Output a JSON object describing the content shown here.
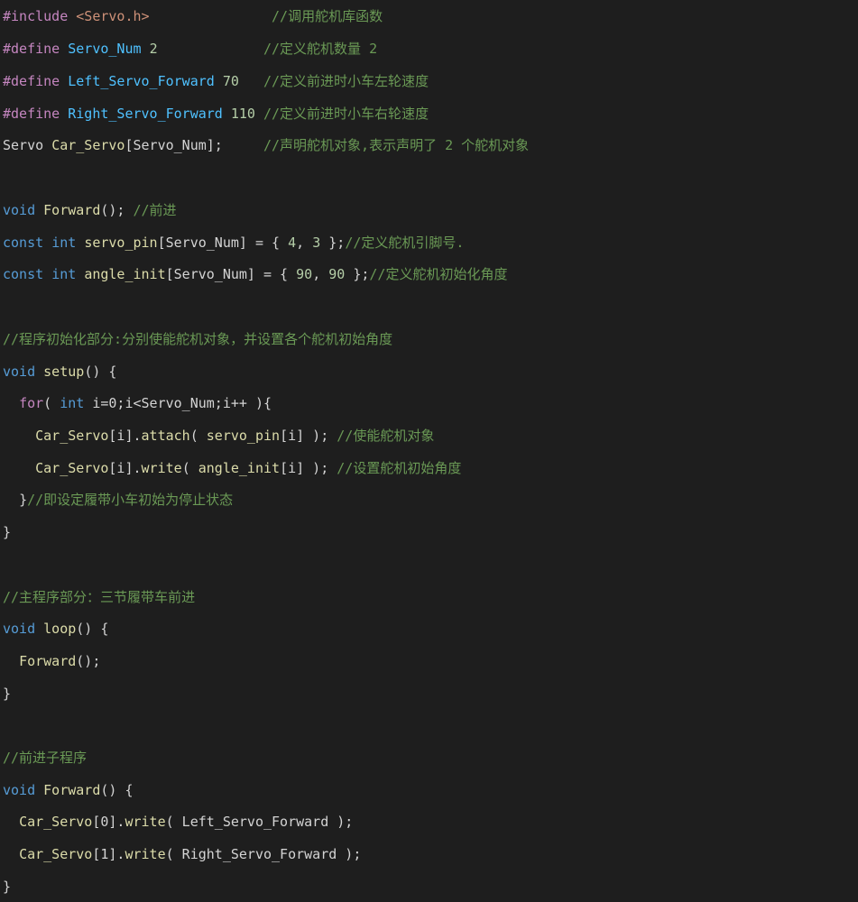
{
  "colors": {
    "background": "#1e1e1e",
    "keyword": "#569cd6",
    "preprocessor": "#c586c0",
    "string": "#ce9178",
    "macro": "#4fc1ff",
    "number": "#b5cea8",
    "function": "#dcdcaa",
    "identifier": "#9cdcfe",
    "comment": "#6a9955",
    "plain": "#d4d4d4"
  },
  "code": {
    "l1": {
      "t1": "#include",
      "t2": " ",
      "t3": "<Servo.h>",
      "t4": "               ",
      "t5": "//调用舵机库函数"
    },
    "l2": {
      "t1": "#define",
      "t2": " ",
      "t3": "Servo_Num",
      "t4": " ",
      "t5": "2",
      "t6": "             ",
      "t7": "//定义舵机数量 2"
    },
    "l3": {
      "t1": "#define",
      "t2": " ",
      "t3": "Left_Servo_Forward",
      "t4": " ",
      "t5": "70",
      "t6": "   ",
      "t7": "//定义前进时小车左轮速度"
    },
    "l4": {
      "t1": "#define",
      "t2": " ",
      "t3": "Right_Servo_Forward",
      "t4": " ",
      "t5": "110",
      "t6": " ",
      "t7": "//定义前进时小车右轮速度"
    },
    "l5": {
      "t1": "Servo",
      "t2": " ",
      "t3": "Car_Servo",
      "t4": "[Servo_Num];",
      "t5": "     ",
      "t6": "//声明舵机对象,表示声明了 2 个舵机对象"
    },
    "l6": {
      "t1": "void",
      "t2": " ",
      "t3": "Forward",
      "t4": "(); ",
      "t5": "//前进"
    },
    "l7": {
      "t1": "const",
      "t2": " ",
      "t3": "int",
      "t4": " ",
      "t5": "servo_pin",
      "t6": "[Servo_Num] = { ",
      "t7": "4",
      "t8": ", ",
      "t9": "3",
      "t10": " };",
      "t11": "//定义舵机引脚号."
    },
    "l8": {
      "t1": "const",
      "t2": " ",
      "t3": "int",
      "t4": " ",
      "t5": "angle_init",
      "t6": "[Servo_Num] = { ",
      "t7": "90",
      "t8": ", ",
      "t9": "90",
      "t10": " };",
      "t11": "//定义舵机初始化角度"
    },
    "l9": {
      "t1": "//程序初始化部分:分别使能舵机对象，并设置各个舵机初始角度"
    },
    "l10": {
      "t1": "void",
      "t2": " ",
      "t3": "setup",
      "t4": "() {"
    },
    "l11": {
      "t0": "  ",
      "t1": "for",
      "t2": "( ",
      "t3": "int",
      "t4": " i=0;i<Servo_Num;i++ ){"
    },
    "l12": {
      "t0": "    ",
      "t1": "Car_Servo",
      "t2": "[i].",
      "t3": "attach",
      "t4": "( ",
      "t5": "servo_pin",
      "t6": "[i] ); ",
      "t7": "//使能舵机对象"
    },
    "l13": {
      "t0": "    ",
      "t1": "Car_Servo",
      "t2": "[i].",
      "t3": "write",
      "t4": "( ",
      "t5": "angle_init",
      "t6": "[i] ); ",
      "t7": "//设置舵机初始角度"
    },
    "l14": {
      "t0": "  ",
      "t1": "}",
      "t2": "//即设定履带小车初始为停止状态"
    },
    "l15": {
      "t1": "}"
    },
    "l16": {
      "t1": "//主程序部分：三节履带车前进"
    },
    "l17": {
      "t1": "void",
      "t2": " ",
      "t3": "loop",
      "t4": "() {"
    },
    "l18": {
      "t0": "  ",
      "t1": "Forward",
      "t2": "();"
    },
    "l19": {
      "t1": "}"
    },
    "l20": {
      "t1": "//前进子程序"
    },
    "l21": {
      "t1": "void",
      "t2": " ",
      "t3": "Forward",
      "t4": "() {"
    },
    "l22": {
      "t0": "  ",
      "t1": "Car_Servo",
      "t2": "[0].",
      "t3": "write",
      "t4": "( Left_Servo_Forward );"
    },
    "l23": {
      "t0": "  ",
      "t1": "Car_Servo",
      "t2": "[1].",
      "t3": "write",
      "t4": "( Right_Servo_Forward );"
    },
    "l24": {
      "t1": "}"
    }
  }
}
